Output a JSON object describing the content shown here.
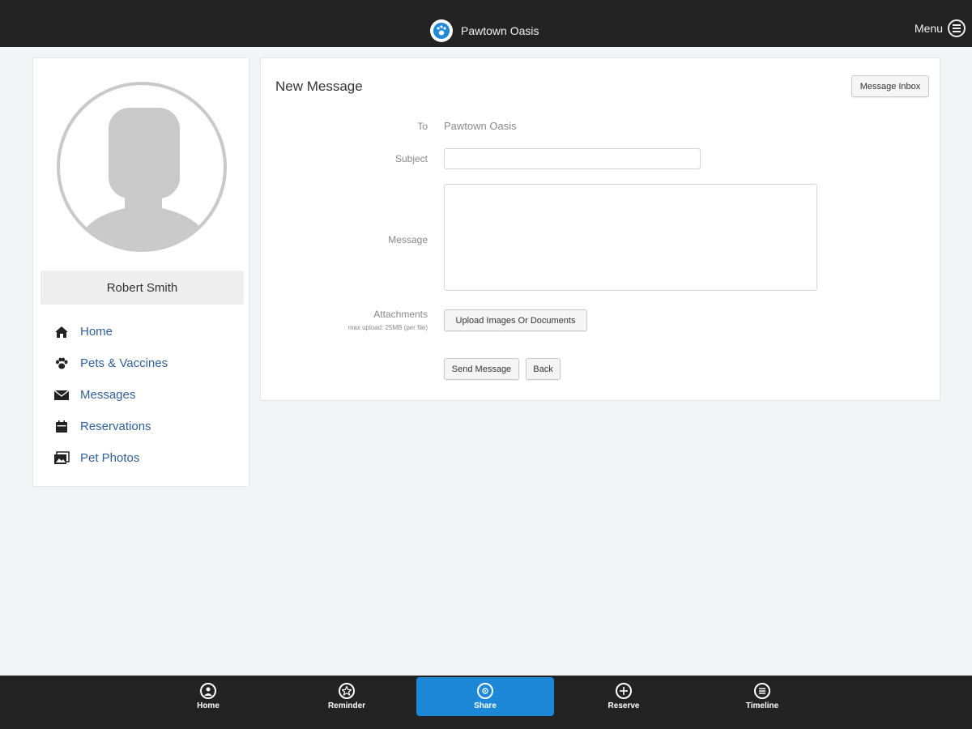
{
  "header": {
    "brand_name": "Pawtown Oasis",
    "menu_label": "Menu",
    "logo_icon": "paw-logo-icon",
    "bg_color": "#232323"
  },
  "sidebar": {
    "user_name": "Robert Smith",
    "avatar_icon": "user-silhouette-icon",
    "items": [
      {
        "label": "Home",
        "icon": "home-icon"
      },
      {
        "label": "Pets & Vaccines",
        "icon": "paw-icon"
      },
      {
        "label": "Messages",
        "icon": "envelope-icon"
      },
      {
        "label": "Reservations",
        "icon": "calendar-icon"
      },
      {
        "label": "Pet Photos",
        "icon": "photo-icon"
      }
    ],
    "link_color": "#2f5f9a"
  },
  "compose": {
    "title": "New Message",
    "inbox_button": "Message Inbox",
    "to_label": "To",
    "to_value": "Pawtown Oasis",
    "subject_label": "Subject",
    "subject_value": "",
    "message_label": "Message",
    "message_value": "",
    "attachments_label": "Attachments",
    "attachments_note": "max upload: 25MB (per file)",
    "upload_button": "Upload Images Or Documents",
    "send_button": "Send Message",
    "back_button": "Back"
  },
  "tabbar": {
    "items": [
      {
        "label": "Home",
        "icon": "user-circle-icon",
        "active": false
      },
      {
        "label": "Reminder",
        "icon": "star-circle-icon",
        "active": false
      },
      {
        "label": "Share",
        "icon": "share-circle-icon",
        "active": true
      },
      {
        "label": "Reserve",
        "icon": "plus-circle-icon",
        "active": false
      },
      {
        "label": "Timeline",
        "icon": "timeline-circle-icon",
        "active": false
      }
    ],
    "active_color": "#1e88d8"
  }
}
